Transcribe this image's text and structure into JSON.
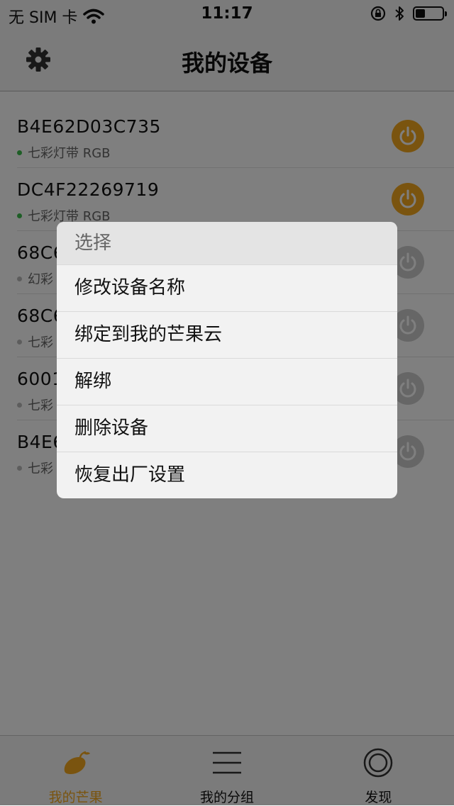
{
  "status_bar": {
    "carrier": "无 SIM 卡",
    "time": "11:17",
    "battery_level": 0.35
  },
  "nav": {
    "title": "我的设备"
  },
  "devices": [
    {
      "name": "B4E62D03C735",
      "type": "七彩灯带 RGB",
      "online": true
    },
    {
      "name": "DC4F22269719",
      "type": "七彩灯带 RGB",
      "online": true
    },
    {
      "name": "68C6",
      "type": "幻彩",
      "online": false
    },
    {
      "name": "68C6",
      "type": "七彩",
      "online": false
    },
    {
      "name": "6001",
      "type": "七彩",
      "online": false
    },
    {
      "name": "B4E6",
      "type": "七彩",
      "online": false
    }
  ],
  "action_sheet": {
    "title": "选择",
    "items": [
      "修改设备名称",
      "绑定到我的芒果云",
      "解绑",
      "删除设备",
      "恢复出厂设置"
    ]
  },
  "tabs": [
    {
      "label": "我的芒果",
      "active": true
    },
    {
      "label": "我的分组",
      "active": false
    },
    {
      "label": "发现",
      "active": false
    }
  ],
  "colors": {
    "accent": "#f5a91f",
    "online_dot": "#3cbd4d",
    "offline": "#cccccc"
  }
}
